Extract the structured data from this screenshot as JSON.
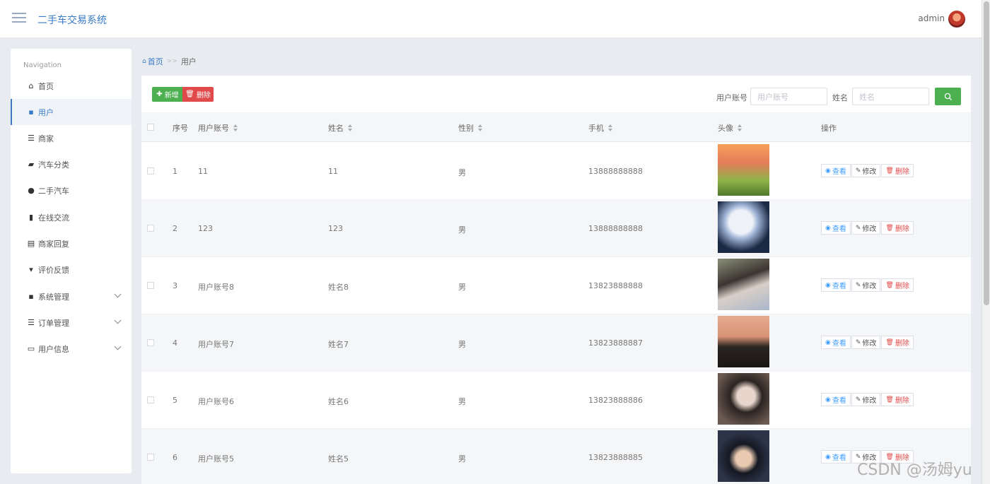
{
  "header": {
    "app_title": "二手车交易系统",
    "admin_name": "admin"
  },
  "sidebar": {
    "title": "Navigation",
    "items": [
      {
        "label": "首页",
        "icon": "home-icon"
      },
      {
        "label": "用户",
        "icon": "grid-icon",
        "active": true
      },
      {
        "label": "商家",
        "icon": "sliders-icon"
      },
      {
        "label": "汽车分类",
        "icon": "wallet-icon"
      },
      {
        "label": "二手汽车",
        "icon": "user-icon"
      },
      {
        "label": "在线交流",
        "icon": "book-icon"
      },
      {
        "label": "商家回复",
        "icon": "clipboard-icon"
      },
      {
        "label": "评价反馈",
        "icon": "paint-roller-icon"
      },
      {
        "label": "系统管理",
        "icon": "grid-icon",
        "expandable": true
      },
      {
        "label": "订单管理",
        "icon": "list-icon",
        "expandable": true
      },
      {
        "label": "用户信息",
        "icon": "card-icon",
        "expandable": true
      }
    ]
  },
  "breadcrumb": {
    "home": "首页",
    "separator": ">>",
    "current": "用户"
  },
  "toolbar": {
    "add_label": "新增",
    "delete_label": "删除",
    "account_label": "用户账号",
    "account_placeholder": "用户账号",
    "name_label": "姓名",
    "name_placeholder": "姓名"
  },
  "table": {
    "columns": [
      "序号",
      "用户账号",
      "姓名",
      "性别",
      "手机",
      "头像",
      "操作"
    ],
    "rows": [
      {
        "index": "1",
        "account": "11",
        "name": "11",
        "gender": "男",
        "phone": "13888888888"
      },
      {
        "index": "2",
        "account": "123",
        "name": "123",
        "gender": "男",
        "phone": "13888888888"
      },
      {
        "index": "3",
        "account": "用户账号8",
        "name": "姓名8",
        "gender": "男",
        "phone": "13823888888"
      },
      {
        "index": "4",
        "account": "用户账号7",
        "name": "姓名7",
        "gender": "男",
        "phone": "13823888887"
      },
      {
        "index": "5",
        "account": "用户账号6",
        "name": "姓名6",
        "gender": "男",
        "phone": "13823888886"
      },
      {
        "index": "6",
        "account": "用户账号5",
        "name": "姓名5",
        "gender": "男",
        "phone": "13823888885"
      }
    ],
    "actions": {
      "view": "查看",
      "edit": "修改",
      "delete": "删除"
    }
  },
  "watermark": "CSDN @汤姆yu",
  "colors": {
    "primary": "#3a7bc8",
    "success": "#4caf50",
    "danger": "#e04a4a",
    "view": "#409eff"
  }
}
